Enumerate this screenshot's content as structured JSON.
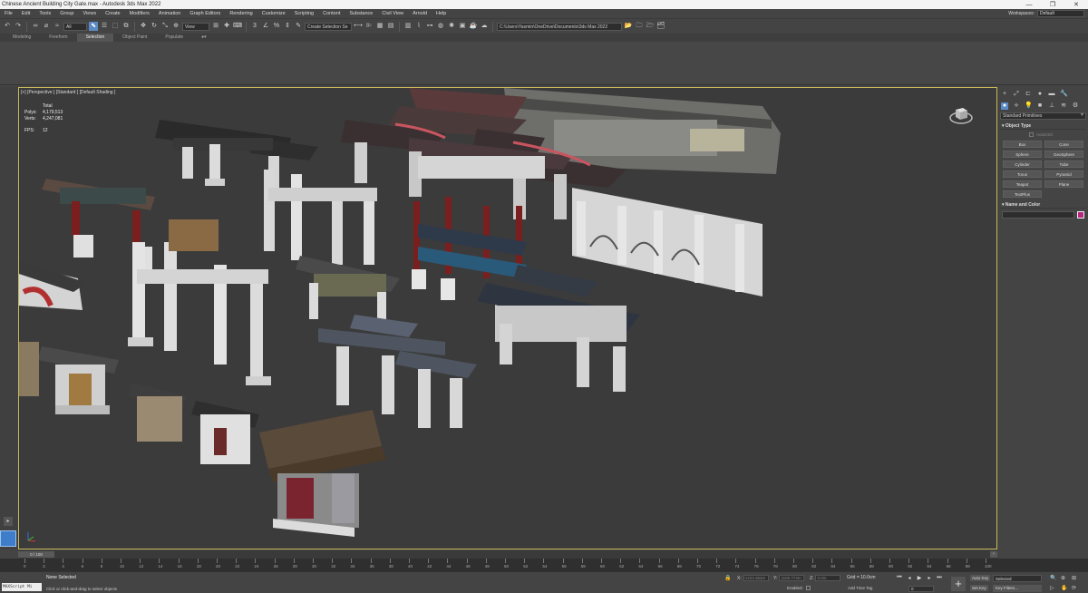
{
  "window": {
    "title": "Chinese Ancient Building City Gate.max - Autodesk 3ds Max 2022",
    "minimize": "—",
    "maximize": "❐",
    "close": "✕"
  },
  "menu": {
    "items": [
      "File",
      "Edit",
      "Tools",
      "Group",
      "Views",
      "Create",
      "Modifiers",
      "Animation",
      "Graph Editors",
      "Rendering",
      "Customize",
      "Scripting",
      "Content",
      "Substance",
      "Civil View",
      "Arnold",
      "Help"
    ],
    "workspaces_label": "Workspaces:",
    "workspaces_value": "Default"
  },
  "toolbar": {
    "filter_value": "All",
    "view_value": "View",
    "selection_set": "Create Selection Se",
    "project_path": "C:\\Users\\Yasmin\\OneDrive\\Documents\\3ds Max 2022"
  },
  "ribbon": {
    "tabs": [
      "Modeling",
      "Freeform",
      "Selection",
      "Object Paint",
      "Populate"
    ],
    "active_tab": "Selection"
  },
  "viewport": {
    "label": "[+] [Perspective ] [Standard ] [Default Shading ]",
    "stats_total": "Total",
    "polys_label": "Polys:",
    "polys_value": "4,179,513",
    "verts_label": "Verts:",
    "verts_value": "4,247,081",
    "fps_label": "FPS:",
    "fps_value": "12"
  },
  "command_panel": {
    "dropdown": "Standard Primitives",
    "object_type_title": "Object Type",
    "autogrid": "AutoGrid",
    "primitives": [
      "Box",
      "Cone",
      "Sphere",
      "GeoSphere",
      "Cylinder",
      "Tube",
      "Torus",
      "Pyramid",
      "Teapot",
      "Plane",
      "TextPlus"
    ],
    "name_color_title": "Name and Color",
    "object_color": "#b8277f"
  },
  "timeline": {
    "frame_display": "0 / 100",
    "tick_labels": [
      "0",
      "2",
      "4",
      "6",
      "8",
      "10",
      "12",
      "14",
      "16",
      "18",
      "20",
      "22",
      "24",
      "26",
      "28",
      "30",
      "32",
      "34",
      "36",
      "38",
      "40",
      "42",
      "44",
      "46",
      "48",
      "50",
      "52",
      "54",
      "56",
      "58",
      "60",
      "62",
      "64",
      "66",
      "68",
      "70",
      "72",
      "74",
      "76",
      "78",
      "80",
      "82",
      "84",
      "86",
      "88",
      "90",
      "92",
      "94",
      "96",
      "98",
      "100"
    ]
  },
  "status": {
    "maxscript": "MAXScript Mi",
    "selection_state": "None Selected",
    "prompt": "Click or click-and-drag to select objects",
    "x_label": "X:",
    "x_value": "1223.363m",
    "y_label": "Y:",
    "y_value": "1100.774m",
    "z_label": "Z:",
    "z_value": "0.0m",
    "grid": "Grid = 10.0cm",
    "enabled": "Enabled:",
    "add_time_tag": "Add Time Tag",
    "current_frame": "0",
    "auto_key": "Auto Key",
    "set_key": "Set Key",
    "selected": "Selected",
    "key_filters": "Key Filters..."
  }
}
